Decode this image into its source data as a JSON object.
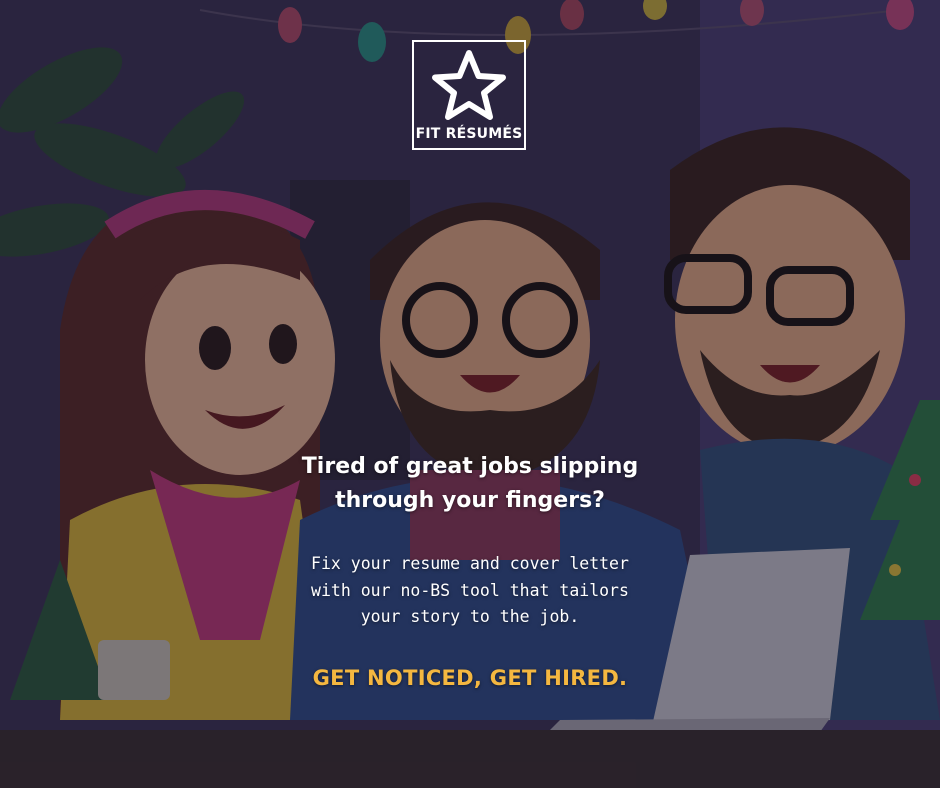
{
  "brand": {
    "name": "FIT RÉSUMÉS",
    "logo_icon": "star-icon",
    "logo_color": "#ffffff"
  },
  "headline": "Tired of great jobs slipping through your fingers?",
  "subtext": "Fix your resume and cover letter with our no-BS tool that tailors your story to the job.",
  "cta": "GET NOTICED, GET HIRED.",
  "colors": {
    "cta": "#f4b740",
    "text": "#ffffff",
    "background": "#2e2842"
  }
}
